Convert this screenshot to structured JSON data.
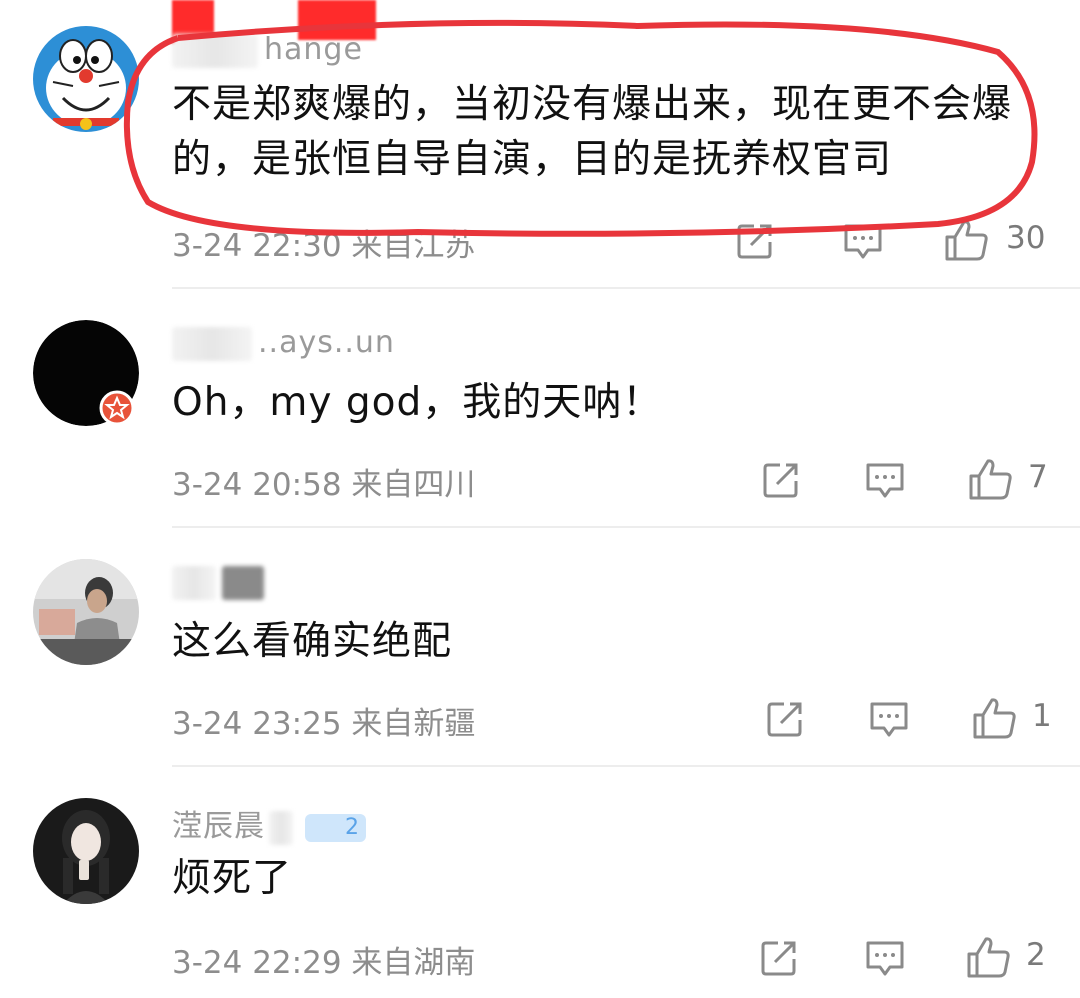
{
  "comments": [
    {
      "username": "hange",
      "text": "不是郑爽爆的，当初没有爆出来，现在更不会爆的，是张恒自导自演，目的是抚养权官司",
      "date": "3-24 22:30",
      "location": "来自江苏",
      "likes": "30",
      "avatar": "doraemon-avatar",
      "highlighted": true
    },
    {
      "username": "..ays..un",
      "text": "Oh，my god，我的天呐！",
      "date": "3-24 20:58",
      "location": "来自四川",
      "likes": "7",
      "avatar": "black-avatar-with-badge"
    },
    {
      "username": "",
      "text": "这么看确实绝配",
      "date": "3-24 23:25",
      "location": "来自新疆",
      "likes": "1",
      "avatar": "photo-avatar"
    },
    {
      "username": "滢辰晨",
      "badge": "2",
      "text": "烦死了",
      "date": "3-24 22:29",
      "location": "来自湖南",
      "likes": "2",
      "avatar": "woman-avatar"
    }
  ],
  "icons": {
    "share": "share-icon",
    "reply": "comment-icon",
    "like": "thumbs-up-icon"
  },
  "colors": {
    "highlight_ring": "#e8353b",
    "text": "#111111",
    "meta": "#8d8d8d",
    "badge": "#5aa3e8"
  }
}
